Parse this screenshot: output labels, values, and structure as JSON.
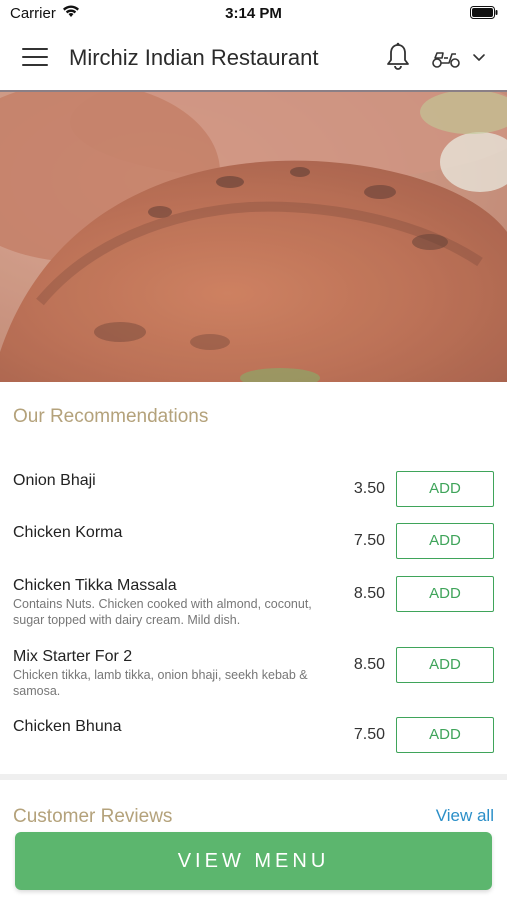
{
  "status_bar": {
    "carrier": "Carrier",
    "time": "3:14 PM"
  },
  "header": {
    "title": "Mirchiz Indian Restaurant",
    "icons": [
      "menu-icon",
      "bell-icon",
      "scooter-icon",
      "chevron-down-icon"
    ]
  },
  "recommendations": {
    "title": "Our Recommendations",
    "items": [
      {
        "name": "Onion Bhaji",
        "description": "",
        "price": "3.50",
        "button": "ADD"
      },
      {
        "name": "Chicken Korma",
        "description": "",
        "price": "7.50",
        "button": "ADD"
      },
      {
        "name": "Chicken Tikka Massala",
        "description": "Contains Nuts. Chicken cooked with almond, coconut, sugar topped with dairy cream. Mild dish.",
        "price": "8.50",
        "button": "ADD"
      },
      {
        "name": "Mix Starter For 2",
        "description": "Chicken tikka, lamb tikka, onion bhaji, seekh kebab & samosa.",
        "price": "8.50",
        "button": "ADD"
      },
      {
        "name": "Chicken Bhuna",
        "description": "",
        "price": "7.50",
        "button": "ADD"
      }
    ]
  },
  "reviews": {
    "title": "Customer Reviews",
    "view_all": "View all"
  },
  "footer": {
    "view_menu": "VIEW MENU"
  },
  "colors": {
    "accent_green": "#3fa45a",
    "button_green": "#5cb66e",
    "section_title": "#b4a27b",
    "link_blue": "#2b8fc8"
  }
}
